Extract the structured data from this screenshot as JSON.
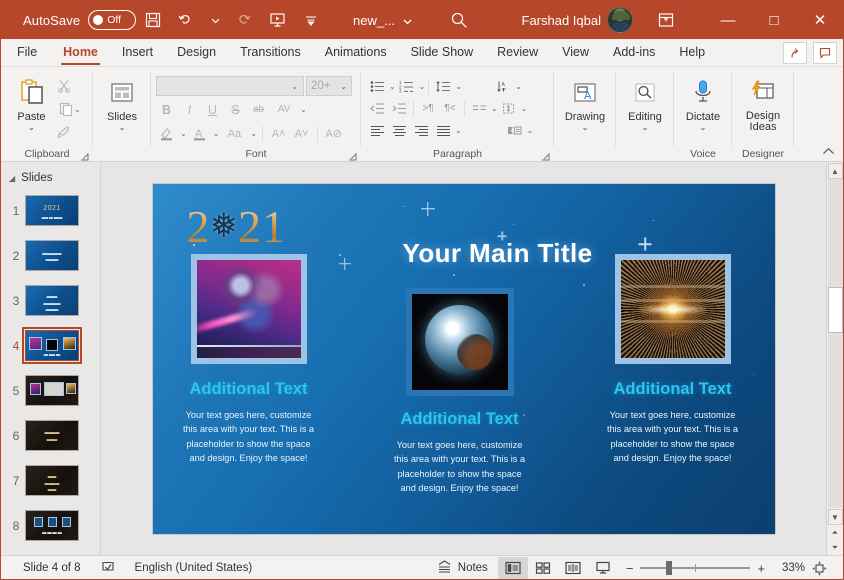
{
  "titlebar": {
    "autosave_label": "AutoSave",
    "autosave_state": "Off",
    "save_icon": "save-icon",
    "undo_icon": "undo-icon",
    "redo_icon": "redo-icon",
    "present_icon": "start-presentation-icon",
    "customize_icon": "customize-quick-access-icon",
    "document_name": "new_...",
    "search_icon": "search-icon",
    "user_name": "Farshad Iqbal",
    "ribbon_display_icon": "ribbon-display-options-icon",
    "minimize": "—",
    "maximize": "□",
    "close": "✕",
    "bg_color": "#b7472a"
  },
  "tabs": [
    {
      "label": "File",
      "active": false
    },
    {
      "label": "Home",
      "active": true
    },
    {
      "label": "Insert",
      "active": false
    },
    {
      "label": "Design",
      "active": false
    },
    {
      "label": "Transitions",
      "active": false
    },
    {
      "label": "Animations",
      "active": false
    },
    {
      "label": "Slide Show",
      "active": false
    },
    {
      "label": "Review",
      "active": false
    },
    {
      "label": "View",
      "active": false
    },
    {
      "label": "Add-ins",
      "active": false
    },
    {
      "label": "Help",
      "active": false
    }
  ],
  "tab_right_buttons": [
    {
      "name": "share-button",
      "glyph": "↪"
    },
    {
      "name": "comments-button",
      "glyph": "❐"
    }
  ],
  "ribbon": {
    "clipboard": {
      "group_label": "Clipboard",
      "paste_label": "Paste",
      "cut_icon": "cut-scissors-icon",
      "copy_icon": "copy-icon",
      "format_painter_icon": "format-painter-icon",
      "dialog_launcher": "clipboard-dialog-launcher"
    },
    "slides": {
      "group_label": "",
      "slides_label": "Slides",
      "slides_icon": "new-slide-icon"
    },
    "font": {
      "group_label": "Font",
      "font_name_value": "",
      "font_size_value": "20+",
      "bold": "B",
      "italic": "I",
      "underline": "U",
      "strikethrough": "S",
      "text_shadow": "ab",
      "character_spacing": "AV",
      "text_highlight_icon": "text-highlight-icon",
      "font_color_icon": "font-color-icon",
      "change_case": "Aa",
      "increase_font": "A˄",
      "decrease_font": "A˅",
      "clear_formatting": "A⊘",
      "dialog_launcher": "font-dialog-launcher"
    },
    "paragraph": {
      "group_label": "Paragraph",
      "bullets_icon": "bullets-icon",
      "numbering_icon": "numbering-icon",
      "line_spacing_icon": "line-spacing-icon",
      "text_direction_icon": "text-direction-icon",
      "decrease_indent_icon": "decrease-indent-icon",
      "increase_indent_icon": "increase-indent-icon",
      "ltr_icon": "left-to-right-icon",
      "rtl_icon": "right-to-left-icon",
      "align_left_icon": "align-left-icon",
      "align_center_icon": "align-center-icon",
      "align_right_icon": "align-right-icon",
      "justify_icon": "justify-icon",
      "columns_icon": "columns-icon",
      "align_text_icon": "align-text-icon",
      "convert_smartart_icon": "convert-to-smartart-icon",
      "dialog_launcher": "paragraph-dialog-launcher"
    },
    "drawing": {
      "group_label": "",
      "label": "Drawing",
      "icon": "drawing-shapes-icon"
    },
    "editing": {
      "group_label": "",
      "label": "Editing",
      "icon": "find-magnifier-icon"
    },
    "voice": {
      "group_label": "Voice",
      "label": "Dictate",
      "icon": "microphone-icon"
    },
    "designer": {
      "group_label": "Designer",
      "label_line1": "Design",
      "label_line2": "Ideas",
      "icon": "design-ideas-icon"
    },
    "collapse_icon": "collapse-ribbon-icon"
  },
  "thumbnails": {
    "header": "Slides",
    "collapse_icon": "collapse-panel-icon",
    "items": [
      {
        "number": "1",
        "theme": "blue",
        "selected": false,
        "caption": "2021"
      },
      {
        "number": "2",
        "theme": "blue",
        "selected": false,
        "caption": ""
      },
      {
        "number": "3",
        "theme": "blue",
        "selected": false,
        "caption": ""
      },
      {
        "number": "4",
        "theme": "blue",
        "selected": true,
        "caption": ""
      },
      {
        "number": "5",
        "theme": "dark",
        "selected": false,
        "caption": ""
      },
      {
        "number": "6",
        "theme": "dark",
        "selected": false,
        "caption": ""
      },
      {
        "number": "7",
        "theme": "dark",
        "selected": false,
        "caption": ""
      },
      {
        "number": "8",
        "theme": "dark",
        "selected": false,
        "caption": ""
      }
    ]
  },
  "slide": {
    "year": "2",
    "year_tail": "21",
    "snowflake": "❅",
    "title": "Your Main Title",
    "accent_color": "#29c7f0",
    "columns": [
      {
        "heading": "Additional Text",
        "body": "Your text goes here, customize this area with your text. This is a placeholder to show the space and design. Enjoy the space!",
        "image_name": "ornament-balls-photo"
      },
      {
        "heading": "Additional Text",
        "body": "Your text goes here, customize this area with your text. This is a placeholder to show the space and design. Enjoy the space!",
        "image_name": "disco-ball-planet-photo"
      },
      {
        "heading": "Additional Text",
        "body": "Your text goes here, customize this area with your text. This is a placeholder to show the space and design. Enjoy the space!",
        "image_name": "light-burst-photo"
      }
    ]
  },
  "statusbar": {
    "slide_counter": "Slide 4 of 8",
    "spellcheck_icon": "accessibility-icon",
    "language": "English (United States)",
    "notes_label": "Notes",
    "notes_icon": "notes-icon",
    "views": [
      {
        "name": "normal-view-button",
        "icon": "normal-view-icon",
        "active": true
      },
      {
        "name": "slide-sorter-button",
        "icon": "slide-sorter-icon",
        "active": false
      },
      {
        "name": "reading-view-button",
        "icon": "reading-view-icon",
        "active": false
      },
      {
        "name": "slideshow-button",
        "icon": "slideshow-icon",
        "active": false
      }
    ],
    "zoom_out": "−",
    "zoom_in": "+",
    "zoom_value": "33%",
    "fit_icon": "fit-slide-to-window-icon"
  }
}
